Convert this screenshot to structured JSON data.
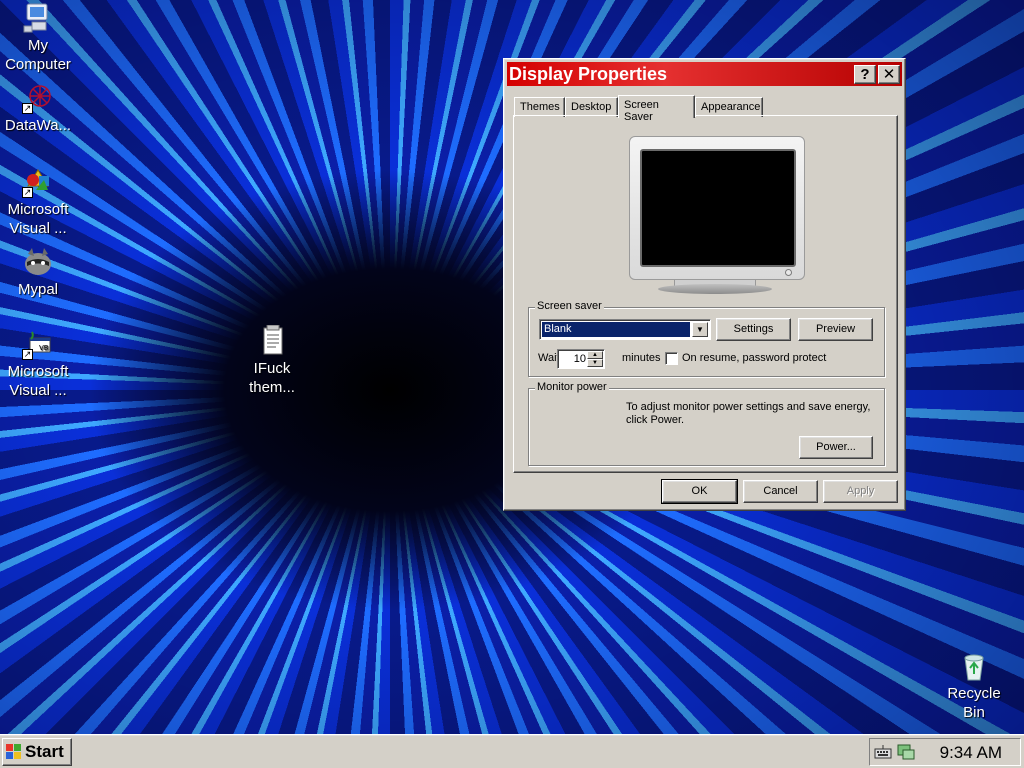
{
  "desktop": {
    "icons": [
      {
        "label": "My\nComputer",
        "icon": "my-computer-icon"
      },
      {
        "label": "DataWa...",
        "icon": "datawa-icon"
      },
      {
        "label": "Microsoft\nVisual ...",
        "icon": "visual-studio-icon"
      },
      {
        "label": "Mypal",
        "icon": "mypal-icon"
      },
      {
        "label": "Microsoft\nVisual ...",
        "icon": "visual-basic-icon"
      },
      {
        "label": "IFuck\nthem...",
        "icon": "text-file-icon"
      },
      {
        "label": "Recycle\nBin",
        "icon": "recycle-bin-icon"
      }
    ]
  },
  "dialog": {
    "title": "Display Properties",
    "help_label": "?",
    "close_label": "✕",
    "tabs": [
      {
        "label": "Themes",
        "active": false
      },
      {
        "label": "Desktop",
        "active": false
      },
      {
        "label": "Screen Saver",
        "active": true
      },
      {
        "label": "Appearance",
        "active": false
      }
    ],
    "screensaver": {
      "group_label": "Screen saver",
      "selected": "Blank",
      "settings_label": "Settings",
      "preview_label": "Preview",
      "wait_label": "Wait:",
      "wait_value": "10",
      "minutes_label": "minutes",
      "password_label": "On resume, password protect",
      "password_checked": false
    },
    "monitor_power": {
      "group_label": "Monitor power",
      "description": "To adjust monitor power settings and save energy,\nclick Power.",
      "power_label": "Power..."
    },
    "buttons": {
      "ok": "OK",
      "cancel": "Cancel",
      "apply": "Apply"
    }
  },
  "taskbar": {
    "start_label": "Start",
    "clock": "9:34 AM"
  },
  "colors": {
    "title_bar": "#d40000",
    "face": "#d4d0c8",
    "selection": "#0a246a",
    "wallpaper": "#0a2fd8"
  }
}
